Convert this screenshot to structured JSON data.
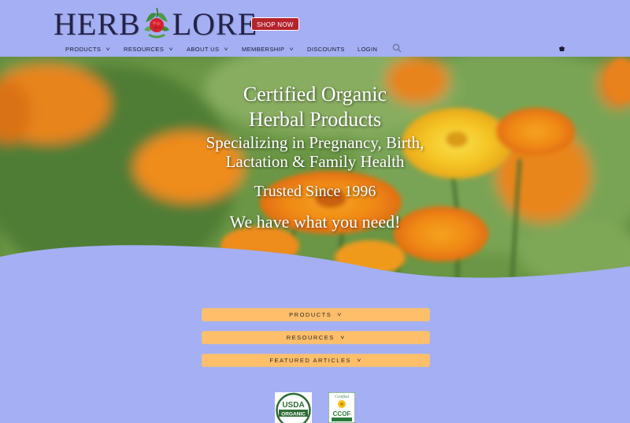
{
  "brand": {
    "logo_left": "HERB",
    "logo_right": "LORE",
    "shop_button": "SHOP NOW"
  },
  "nav": {
    "items": [
      {
        "label": "PRODUCTS",
        "chevron": true
      },
      {
        "label": "RESOURCES",
        "chevron": true
      },
      {
        "label": "ABOUT US",
        "chevron": true
      },
      {
        "label": "MEMBERSHIP",
        "chevron": true
      },
      {
        "label": "DISCOUNTS",
        "chevron": false
      },
      {
        "label": "LOGIN",
        "chevron": false
      }
    ],
    "search_icon": "search-icon",
    "cart_icon": "cart-icon"
  },
  "hero": {
    "line1": "Certified Organic",
    "line2": "Herbal Products",
    "line3": "Specializing in Pregnancy, Birth,",
    "line4": "Lactation & Family Health",
    "line5": "Trusted Since 1996",
    "line6": "We have what you need!"
  },
  "accordion": [
    {
      "label": "PRODUCTS"
    },
    {
      "label": "RESOURCES"
    },
    {
      "label": "FEATURED ARTICLES"
    }
  ],
  "badges": {
    "usda_line1": "USDA",
    "usda_line2": "ORGANIC",
    "ccof_top": "Certified",
    "ccof_main": "CCOF"
  },
  "colors": {
    "background": "#a5aff3",
    "shop_button": "#b5232d",
    "accordion": "#ffbe6a"
  }
}
